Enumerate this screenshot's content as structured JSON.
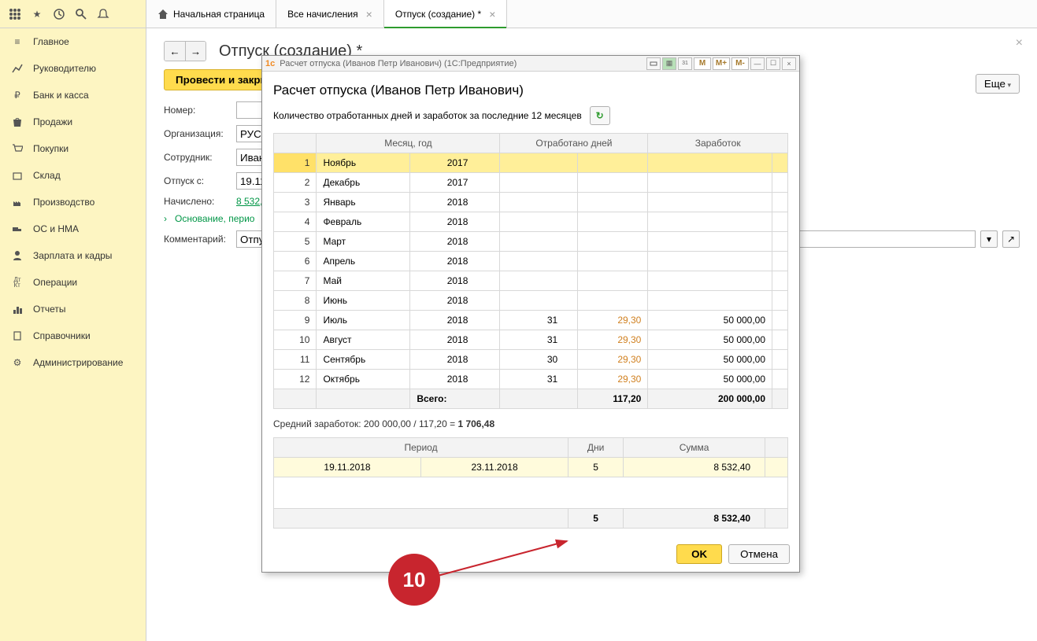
{
  "tabs": {
    "home": "Начальная страница",
    "all": "Все начисления",
    "vac": "Отпуск (создание) *"
  },
  "sidebar": [
    "Главное",
    "Руководителю",
    "Банк и касса",
    "Продажи",
    "Покупки",
    "Склад",
    "Производство",
    "ОС и НМА",
    "Зарплата и кадры",
    "Операции",
    "Отчеты",
    "Справочники",
    "Администрирование"
  ],
  "main": {
    "title": "Отпуск (создание) *",
    "submit_btn": "Провести и закрыть",
    "more": "Еще",
    "number_label": "Номер:",
    "org_label": "Организация:",
    "org_value": "РУС-L",
    "emp_label": "Сотрудник:",
    "emp_value": "Ивано",
    "from_label": "Отпуск с:",
    "from_value": "19.11.",
    "accrued_label": "Начислено:",
    "accrued_value": "8 532,",
    "basis_label": "Основание, перио",
    "comment_label": "Комментарий:",
    "comment_value": "Отпус"
  },
  "dialog": {
    "titlebar": "Расчет отпуска (Иванов Петр Иванович)  (1С:Предприятие)",
    "heading": "Расчет отпуска (Иванов Петр Иванович)",
    "subtitle": "Количество отработанных дней и заработок за последние 12 месяцев",
    "m_buttons": [
      "M",
      "M+",
      "M-"
    ],
    "headers": {
      "month": "Месяц, год",
      "days": "Отработано дней",
      "earn": "Заработок"
    },
    "rows": [
      {
        "n": "1",
        "m": "Ноябрь",
        "y": "2017",
        "d": "",
        "f": "",
        "e": ""
      },
      {
        "n": "2",
        "m": "Декабрь",
        "y": "2017",
        "d": "",
        "f": "",
        "e": ""
      },
      {
        "n": "3",
        "m": "Январь",
        "y": "2018",
        "d": "",
        "f": "",
        "e": ""
      },
      {
        "n": "4",
        "m": "Февраль",
        "y": "2018",
        "d": "",
        "f": "",
        "e": ""
      },
      {
        "n": "5",
        "m": "Март",
        "y": "2018",
        "d": "",
        "f": "",
        "e": ""
      },
      {
        "n": "6",
        "m": "Апрель",
        "y": "2018",
        "d": "",
        "f": "",
        "e": ""
      },
      {
        "n": "7",
        "m": "Май",
        "y": "2018",
        "d": "",
        "f": "",
        "e": ""
      },
      {
        "n": "8",
        "m": "Июнь",
        "y": "2018",
        "d": "",
        "f": "",
        "e": ""
      },
      {
        "n": "9",
        "m": "Июль",
        "y": "2018",
        "d": "31",
        "f": "29,30",
        "e": "50 000,00"
      },
      {
        "n": "10",
        "m": "Август",
        "y": "2018",
        "d": "31",
        "f": "29,30",
        "e": "50 000,00"
      },
      {
        "n": "11",
        "m": "Сентябрь",
        "y": "2018",
        "d": "30",
        "f": "29,30",
        "e": "50 000,00"
      },
      {
        "n": "12",
        "m": "Октябрь",
        "y": "2018",
        "d": "31",
        "f": "29,30",
        "e": "50 000,00"
      }
    ],
    "totals": {
      "label": "Всего:",
      "f": "117,20",
      "e": "200 000,00"
    },
    "avg_prefix": "Средний заработок: 200 000,00 / 117,20 = ",
    "avg_bold": "1 706,48",
    "headers2": {
      "period": "Период",
      "days": "Дни",
      "sum": "Сумма"
    },
    "row2": {
      "from": "19.11.2018",
      "to": "23.11.2018",
      "days": "5",
      "sum": "8 532,40"
    },
    "totals2": {
      "days": "5",
      "sum": "8 532,40"
    },
    "ok": "OK",
    "cancel": "Отмена"
  },
  "annotation": "10"
}
